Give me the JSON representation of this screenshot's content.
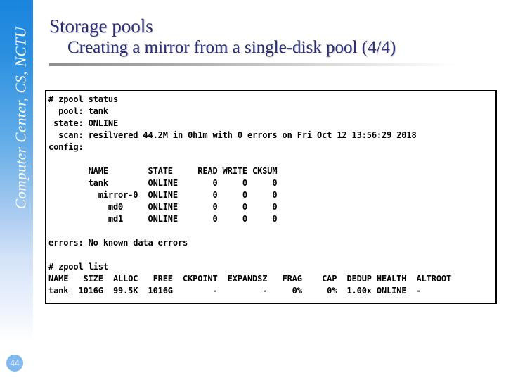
{
  "sidebar": {
    "brand": "Computer Center, CS, NCTU",
    "page_number": "44",
    "gradient_top": "#1a85dd",
    "gradient_bottom": "#ffffff",
    "badge_color": "#7fb9ef"
  },
  "title": {
    "main": "Storage pools",
    "sub": "Creating a mirror from a single-disk pool (4/4)",
    "color": "#2e3076"
  },
  "console": {
    "border_color": "#000000",
    "background": "#ffffff",
    "text_color": "#000000",
    "lines": [
      "# zpool status",
      "  pool: tank",
      " state: ONLINE",
      "  scan: resilvered 44.2M in 0h1m with 0 errors on Fri Oct 12 13:56:29 2018",
      "config:",
      "",
      "        NAME        STATE     READ WRITE CKSUM",
      "        tank        ONLINE       0     0     0",
      "          mirror-0  ONLINE       0     0     0",
      "            md0     ONLINE       0     0     0",
      "            md1     ONLINE       0     0     0",
      "",
      "errors: No known data errors",
      "",
      "# zpool list",
      "NAME   SIZE  ALLOC   FREE  CKPOINT  EXPANDSZ   FRAG    CAP  DEDUP HEALTH  ALTROOT",
      "tank  1016G  99.5K  1016G        -         -     0%     0%  1.00x ONLINE  -"
    ],
    "zpool_status": {
      "command": "# zpool status",
      "pool": "tank",
      "state": "ONLINE",
      "scan": "resilvered 44.2M in 0h1m with 0 errors on Fri Oct 12 13:56:29 2018",
      "config_label": "config:",
      "columns": [
        "NAME",
        "STATE",
        "READ",
        "WRITE",
        "CKSUM"
      ],
      "rows": [
        {
          "name": "tank",
          "indent": 0,
          "state": "ONLINE",
          "read": "0",
          "write": "0",
          "cksum": "0"
        },
        {
          "name": "mirror-0",
          "indent": 1,
          "state": "ONLINE",
          "read": "0",
          "write": "0",
          "cksum": "0"
        },
        {
          "name": "md0",
          "indent": 2,
          "state": "ONLINE",
          "read": "0",
          "write": "0",
          "cksum": "0"
        },
        {
          "name": "md1",
          "indent": 2,
          "state": "ONLINE",
          "read": "0",
          "write": "0",
          "cksum": "0"
        }
      ],
      "errors": "errors: No known data errors"
    },
    "zpool_list": {
      "command": "# zpool list",
      "columns": [
        "NAME",
        "SIZE",
        "ALLOC",
        "FREE",
        "CKPOINT",
        "EXPANDSZ",
        "FRAG",
        "CAP",
        "DEDUP",
        "HEALTH",
        "ALTROOT"
      ],
      "rows": [
        {
          "NAME": "tank",
          "SIZE": "1016G",
          "ALLOC": "99.5K",
          "FREE": "1016G",
          "CKPOINT": "-",
          "EXPANDSZ": "-",
          "FRAG": "0%",
          "CAP": "0%",
          "DEDUP": "1.00x",
          "HEALTH": "ONLINE",
          "ALTROOT": "-"
        }
      ]
    }
  }
}
